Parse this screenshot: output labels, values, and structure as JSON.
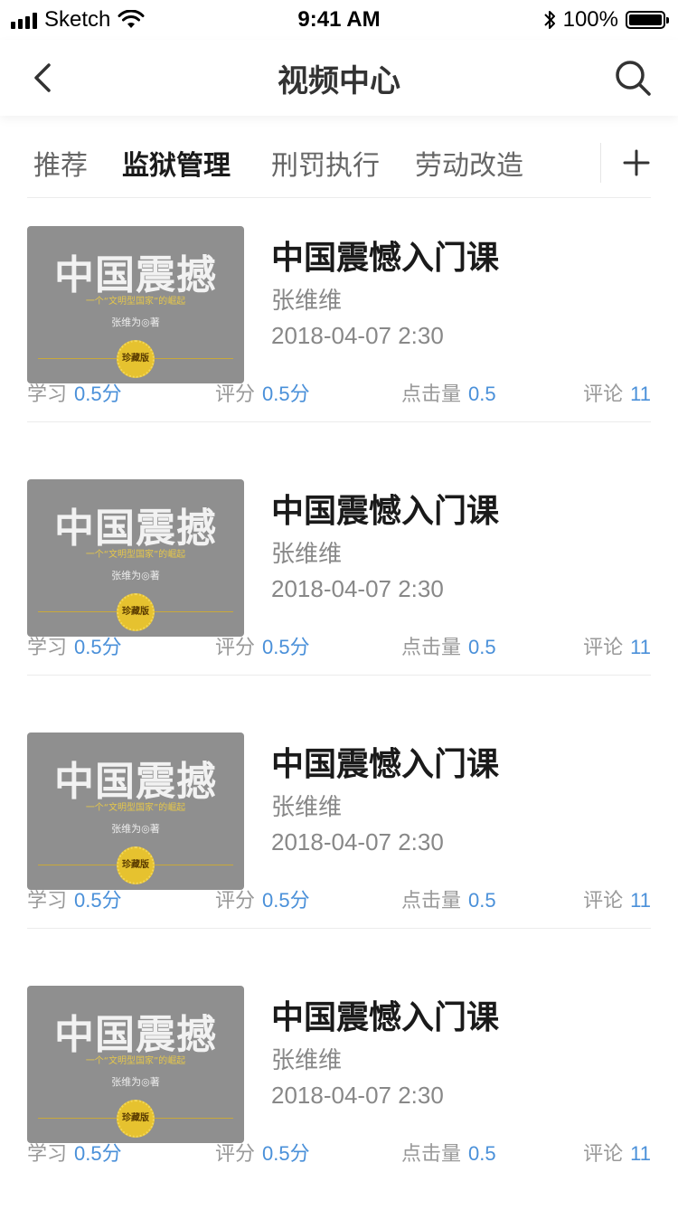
{
  "status_bar": {
    "carrier": "Sketch",
    "time": "9:41 AM",
    "battery": "100%"
  },
  "navbar": {
    "title": "视频中心",
    "back_icon": "chevron-left-icon",
    "search_icon": "search-icon"
  },
  "tabs": [
    {
      "label": "推荐",
      "active": false
    },
    {
      "label": "监狱管理",
      "active": true
    },
    {
      "label": "刑罚执行",
      "active": false
    },
    {
      "label": "劳动改造",
      "active": false
    }
  ],
  "add_tab_icon": "plus-icon",
  "cover": {
    "title": "中国震撼",
    "subtitle": "一个“文明型国家”的崛起",
    "author": "张维为◎著",
    "seal": "珍藏版"
  },
  "videos": [
    {
      "title": "中国震憾入门课",
      "author": "张维维",
      "date": "2018-04-07 2:30",
      "study_label": "学习",
      "study_value": "0.5分",
      "rating_label": "评分",
      "rating_value": "0.5分",
      "clicks_label": "点击量",
      "clicks_value": "0.5",
      "comments_label": "评论",
      "comments_value": "11"
    },
    {
      "title": "中国震憾入门课",
      "author": "张维维",
      "date": "2018-04-07 2:30",
      "study_label": "学习",
      "study_value": "0.5分",
      "rating_label": "评分",
      "rating_value": "0.5分",
      "clicks_label": "点击量",
      "clicks_value": "0.5",
      "comments_label": "评论",
      "comments_value": "11"
    },
    {
      "title": "中国震憾入门课",
      "author": "张维维",
      "date": "2018-04-07 2:30",
      "study_label": "学习",
      "study_value": "0.5分",
      "rating_label": "评分",
      "rating_value": "0.5分",
      "clicks_label": "点击量",
      "clicks_value": "0.5",
      "comments_label": "评论",
      "comments_value": "11"
    },
    {
      "title": "中国震憾入门课",
      "author": "张维维",
      "date": "2018-04-07 2:30",
      "study_label": "学习",
      "study_value": "0.5分",
      "rating_label": "评分",
      "rating_value": "0.5分",
      "clicks_label": "点击量",
      "clicks_value": "0.5",
      "comments_label": "评论",
      "comments_value": "11"
    }
  ],
  "colors": {
    "accent": "#4a90d9",
    "title": "#1a1a1a",
    "muted": "#888888",
    "divider": "#ececec"
  }
}
